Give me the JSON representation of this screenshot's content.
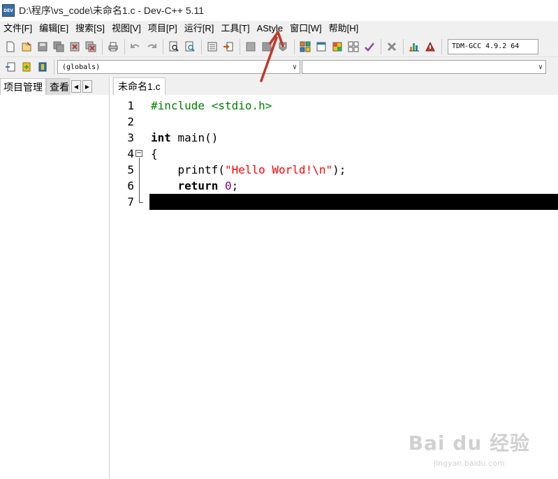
{
  "window": {
    "title": "D:\\程序\\vs_code\\未命名1.c - Dev-C++ 5.11",
    "icon_label": "DEV"
  },
  "menu": [
    {
      "label": "文件[F]"
    },
    {
      "label": "编辑[E]"
    },
    {
      "label": "搜索[S]"
    },
    {
      "label": "视图[V]"
    },
    {
      "label": "项目[P]"
    },
    {
      "label": "运行[R]"
    },
    {
      "label": "工具[T]"
    },
    {
      "label": "AStyle"
    },
    {
      "label": "窗口[W]"
    },
    {
      "label": "帮助[H]"
    }
  ],
  "toolbar": {
    "compiler": "TDM-GCC 4.9.2 64"
  },
  "toolbar2": {
    "scope_combo": "(globals)",
    "member_combo": ""
  },
  "left_panel": {
    "tab_active": "项目管理",
    "tab_inactive": "查看"
  },
  "editor": {
    "tab": "未命名1.c",
    "line_numbers": [
      "1",
      "2",
      "3",
      "4",
      "5",
      "6",
      "7"
    ],
    "code": {
      "line1": "#include <stdio.h>",
      "line3_kw": "int",
      "line3_rest": " main()",
      "line4": "{",
      "line5_a": "    printf(",
      "line5_str": "\"Hello World!\\n\"",
      "line5_b": ");",
      "line6_kw": "    return",
      "line6_sp": " ",
      "line6_num": "0",
      "line6_end": ";"
    },
    "current_line": 7
  },
  "watermark": {
    "logo": "Bai du 经验",
    "url": "jingyan.baidu.com"
  },
  "colors": {
    "preprocessor": "#008000",
    "string": "#ff0000",
    "number": "#800080",
    "annotation_arrow": "#c0392b"
  }
}
